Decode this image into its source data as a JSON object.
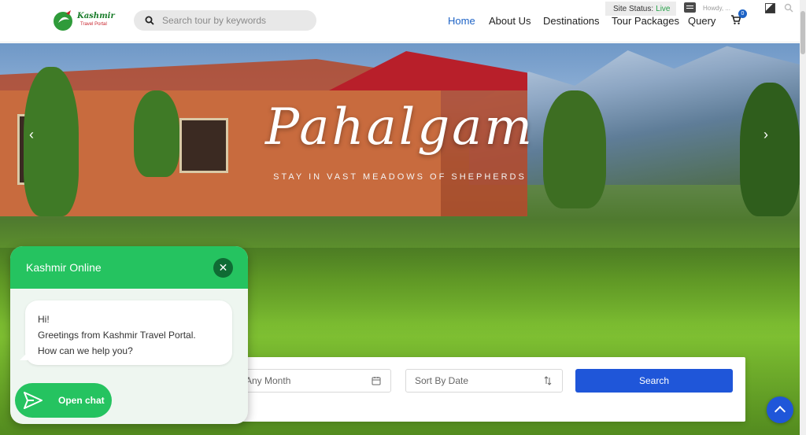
{
  "header": {
    "logo": {
      "line1": "Kashmir",
      "line2": "Travel Portal"
    },
    "search_placeholder": "Search tour by keywords",
    "nav": [
      {
        "label": "Home",
        "active": true
      },
      {
        "label": "About Us",
        "active": false
      },
      {
        "label": "Destinations",
        "active": false
      },
      {
        "label": "Tour Packages",
        "active": false
      },
      {
        "label": "Query",
        "active": false
      }
    ],
    "cart_count": "0",
    "colors": {
      "accent": "#1d63c6",
      "live": "#24a148"
    }
  },
  "admin_bar": {
    "status_label": "Site Status:",
    "status_value": "Live",
    "greeting": "Howdy, ..."
  },
  "hero": {
    "title": "Pahalgam",
    "subtitle": "STAY IN VAST MEADOWS OF SHEPHERDS",
    "prev_icon": "chevron-left-icon",
    "next_icon": "chevron-right-icon"
  },
  "tour_search": {
    "month_placeholder": "Any Month",
    "sort_placeholder": "Sort By Date",
    "button_label": "Search",
    "colors": {
      "button": "#1f56d9"
    }
  },
  "chat": {
    "title": "Kashmir Online",
    "messages": [
      "Hi!",
      "Greetings from Kashmir Travel Portal.",
      "How can we help you?"
    ],
    "open_label": "Open chat",
    "colors": {
      "primary": "#25c360"
    }
  }
}
